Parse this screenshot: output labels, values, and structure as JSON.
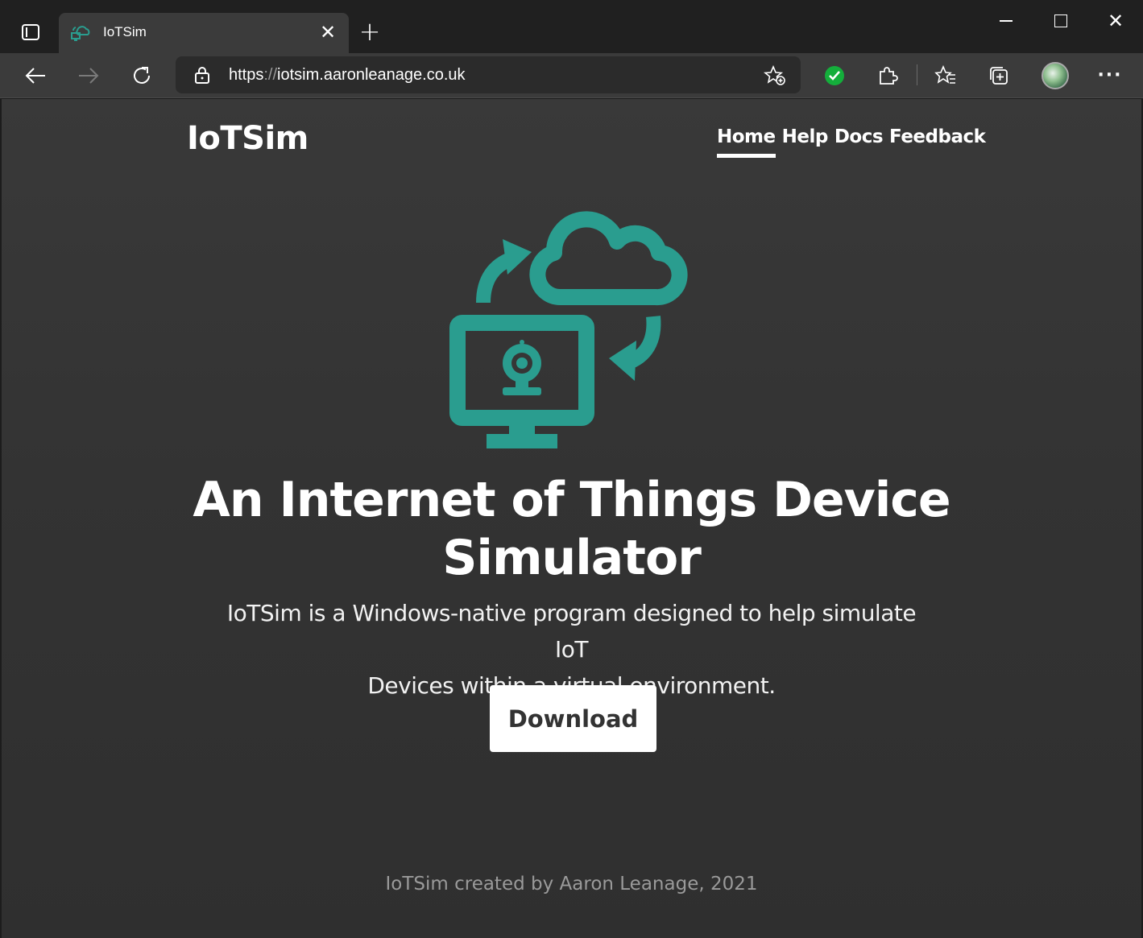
{
  "browser": {
    "tab_title": "IoTSim",
    "url_scheme": "https",
    "url_sep": "://",
    "url_host": "iotsim.aaronleanage.co.uk"
  },
  "site": {
    "brand": "IoTSim",
    "nav": [
      "Home",
      "Help",
      "Docs",
      "Feedback"
    ],
    "active_nav": "Home",
    "headline_line1": "An Internet of Things Device",
    "headline_line2": "Simulator",
    "lead_line1": "IoTSim is a Windows-native program designed to help simulate IoT",
    "lead_line2": "Devices within a virtual environment.",
    "download_label": "Download",
    "footer": "IoTSim created by Aaron Leanage, 2021"
  },
  "colors": {
    "accent": "#2a9d8f",
    "page_bg": "#363636",
    "button_bg": "#ffffff"
  }
}
